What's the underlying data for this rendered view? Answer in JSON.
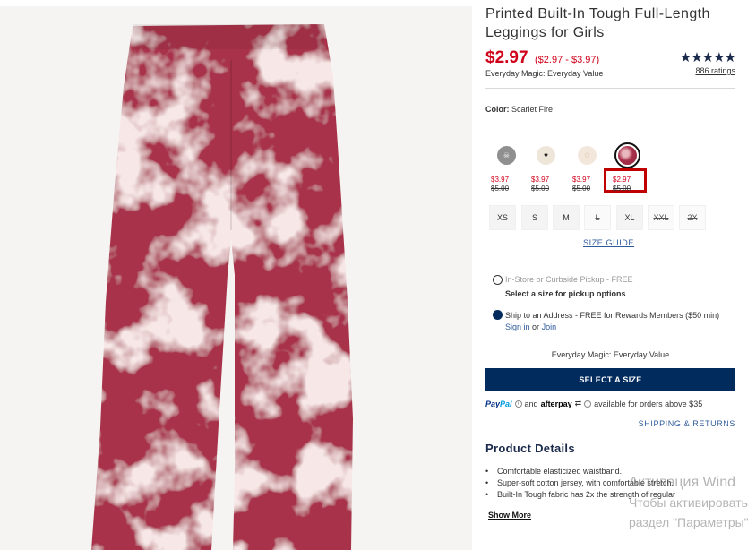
{
  "product": {
    "title": "Printed Built-In Tough Full-Length Leggings for Girls",
    "price": "$2.97",
    "price_range": "($2.97 - $3.97)",
    "everyday_value": "Everyday Magic: Everyday Value",
    "rating_stars": "★★★★★",
    "rating_value": 5,
    "ratings_count": "886 ratings"
  },
  "color": {
    "label": "Color:",
    "selected": "Scarlet Fire",
    "swatches": [
      {
        "price": "$3.97",
        "was": "$5.00",
        "color": "#8f8f8f",
        "icon": "skull-print-icon"
      },
      {
        "price": "$3.97",
        "was": "$5.00",
        "color": "#efe6da",
        "icon": "heart-print-icon"
      },
      {
        "price": "$3.97",
        "was": "$5.00",
        "color": "#f3e7dc",
        "icon": "pale-print-icon"
      },
      {
        "price": "$2.97",
        "was": "$5.00",
        "color": "#a8304a",
        "icon": "tie-dye-icon",
        "selected": true
      }
    ]
  },
  "sizes": [
    {
      "label": "XS",
      "available": true
    },
    {
      "label": "S",
      "available": true
    },
    {
      "label": "M",
      "available": true
    },
    {
      "label": "L",
      "available": false
    },
    {
      "label": "XL",
      "available": true
    },
    {
      "label": "XXL",
      "available": false
    },
    {
      "label": "2X",
      "available": false
    }
  ],
  "size_guide": "SIZE GUIDE",
  "fulfillment": {
    "pickup_label": "In-Store or Curbside Pickup - FREE",
    "pickup_hint": "Select a size for pickup options",
    "ship_label": "Ship to an Address - FREE for Rewards Members ($50 min)",
    "sign_in": "Sign in",
    "or": "or",
    "join": "Join"
  },
  "cta": {
    "everyday_value": "Everyday Magic: Everyday Value",
    "button": "SELECT A SIZE"
  },
  "payment": {
    "paypal_p": "Pay",
    "paypal_pal": "Pal",
    "and": "and",
    "afterpay": "afterpay",
    "note": "available for orders above $35"
  },
  "shipping_returns": "SHIPPING & RETURNS",
  "details": {
    "title": "Product Details",
    "bullets": [
      "Comfortable elasticized waistband.",
      "Super-soft cotton jersey, with comfortable stretch.",
      "Built-In Tough fabric has 2x the strength of regular"
    ],
    "show_more": "Show More"
  },
  "watermark": {
    "line1": "Активация Wind",
    "line2": "Чтобы активировать",
    "line3": "раздел \"Параметры\""
  },
  "colors": {
    "sale_red": "#d0021b",
    "navy": "#002b5c",
    "link_blue": "#2f5b9c",
    "fabric": "#a8304a"
  }
}
